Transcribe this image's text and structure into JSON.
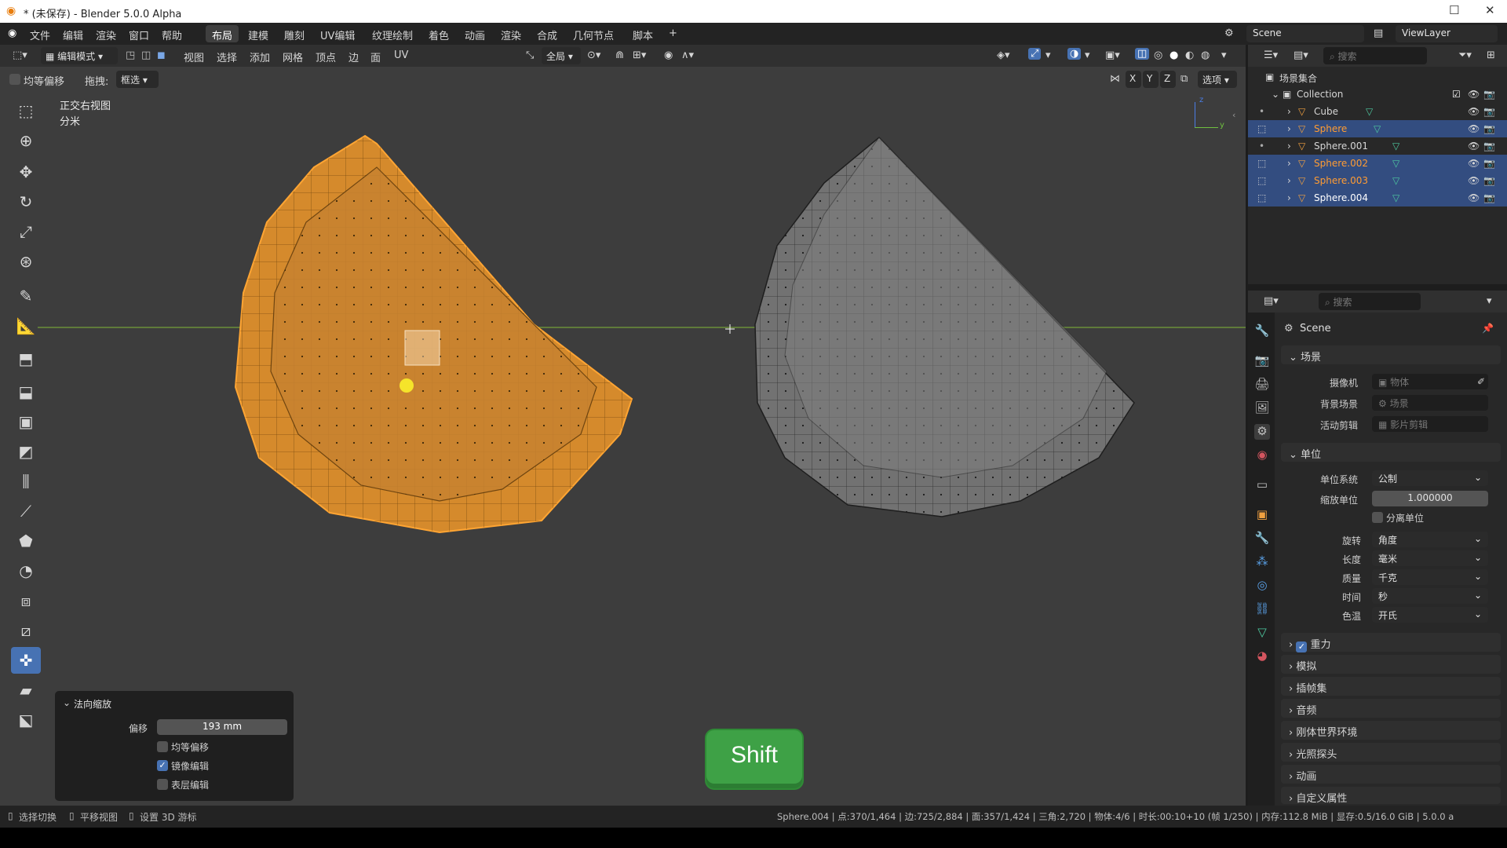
{
  "os": {
    "title": "* (未保存) - Blender 5.0.0 Alpha"
  },
  "menubar": {
    "items": [
      "文件",
      "编辑",
      "渲染",
      "窗口",
      "帮助"
    ],
    "workspaces": [
      "布局",
      "建模",
      "雕刻",
      "UV编辑",
      "纹理绘制",
      "着色",
      "动画",
      "渲染",
      "合成",
      "几何节点",
      "脚本"
    ],
    "active_workspace": "布局",
    "add_tab": "+",
    "scene": "Scene",
    "view_layer": "ViewLayer"
  },
  "viewport_header": {
    "mode": "编辑模式",
    "menus": [
      "视图",
      "选择",
      "添加",
      "网格",
      "顶点",
      "边",
      "面",
      "UV"
    ],
    "transform_orientation": "全局"
  },
  "tool_options": {
    "even_offset_label": "均等偏移",
    "drag_label": "拖拽:",
    "drag_value": "框选",
    "axis_x": "X",
    "axis_y": "Y",
    "axis_z": "Z",
    "options_label": "选项"
  },
  "viewport": {
    "view_name": "正交右视图",
    "unit_label": "分米",
    "axis_z": "z",
    "axis_y": "y"
  },
  "operator_panel": {
    "title": "法向缩放",
    "offset_label": "偏移",
    "offset_value": "193 mm",
    "even_offset": "均等偏移",
    "even_offset_checked": false,
    "mirror_edit": "镜像编辑",
    "mirror_edit_checked": true,
    "surface_snap": "表层编辑",
    "surface_snap_checked": false
  },
  "key_overlay": {
    "key": "Shift"
  },
  "statusbar": {
    "left1": "选择切换",
    "left2": "平移视图",
    "left3": "设置 3D 游标",
    "stats": "Sphere.004 | 点:370/1,464 | 边:725/2,884 | 面:357/1,424 | 三角:2,720 | 物体:4/6 | 时长:00:10+10 (帧 1/250) | 内存:112.8 MiB | 显存:0.5/16.0 GiB | 5.0.0 a"
  },
  "outliner": {
    "search_placeholder": "搜索",
    "scene_collection": "场景集合",
    "collection": "Collection",
    "objects": [
      {
        "name": "Cube",
        "selected": false,
        "orange": false
      },
      {
        "name": "Sphere",
        "selected": true,
        "orange": true
      },
      {
        "name": "Sphere.001",
        "selected": false,
        "orange": false
      },
      {
        "name": "Sphere.002",
        "selected": true,
        "orange": true
      },
      {
        "name": "Sphere.003",
        "selected": true,
        "orange": true
      },
      {
        "name": "Sphere.004",
        "selected": true,
        "orange": false
      }
    ]
  },
  "properties": {
    "search_placeholder": "搜索",
    "context": "Scene",
    "scene_section": "场景",
    "camera_label": "摄像机",
    "camera_value": "物体",
    "background_label": "背景场景",
    "background_value": "场景",
    "clip_label": "活动剪辑",
    "clip_value": "影片剪辑",
    "units_section": "单位",
    "unit_system_label": "单位系统",
    "unit_system_value": "公制",
    "unit_scale_label": "缩放单位",
    "unit_scale_value": "1.000000",
    "separate_units": "分离单位",
    "rotation_label": "旋转",
    "rotation_value": "角度",
    "length_label": "长度",
    "length_value": "毫米",
    "mass_label": "质量",
    "mass_value": "千克",
    "time_label": "时间",
    "time_value": "秒",
    "temperature_label": "色温",
    "temperature_value": "开氏",
    "collapsed_sections": [
      "重力",
      "模拟",
      "插帧集",
      "音频",
      "刚体世界环境",
      "光照探头",
      "动画",
      "自定义属性"
    ]
  }
}
